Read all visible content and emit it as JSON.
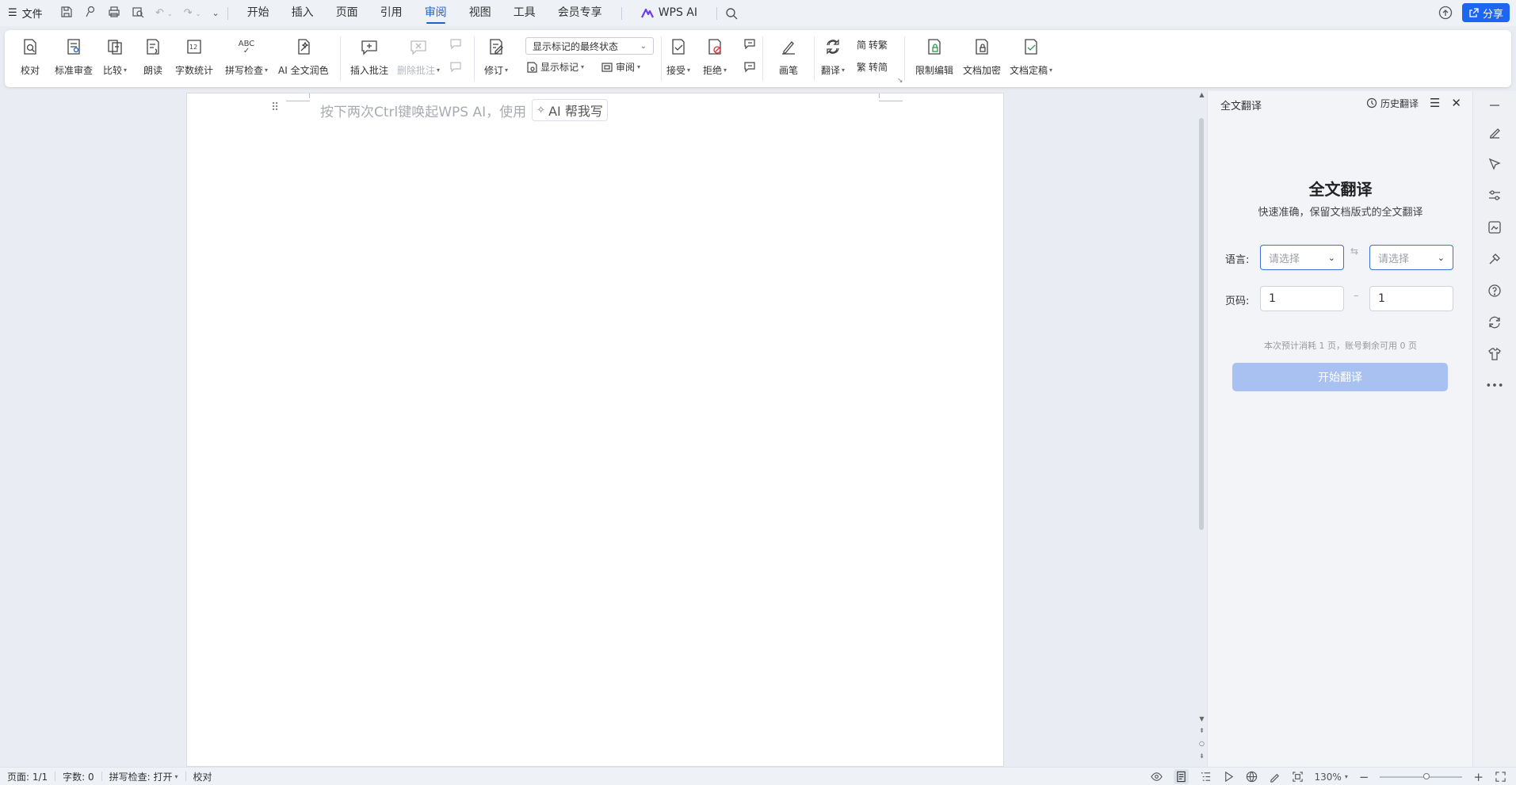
{
  "menubar": {
    "file_label": "文件",
    "tabs": [
      {
        "label": "开始",
        "active": false
      },
      {
        "label": "插入",
        "active": false
      },
      {
        "label": "页面",
        "active": false
      },
      {
        "label": "引用",
        "active": false
      },
      {
        "label": "审阅",
        "active": true
      },
      {
        "label": "视图",
        "active": false
      },
      {
        "label": "工具",
        "active": false
      },
      {
        "label": "会员专享",
        "active": false
      }
    ],
    "wps_ai_label": "WPS AI",
    "share_label": "分享"
  },
  "ribbon": {
    "proofread": "校对",
    "standard_review": "标准审查",
    "compare": "比较",
    "read_aloud": "朗读",
    "word_count": "字数统计",
    "spell_check": "拼写检查",
    "spell_icon_text": "ABC",
    "ai_polish": "AI 全文润色",
    "insert_comment": "插入批注",
    "delete_comment": "删除批注",
    "revise": "修订",
    "markup_state": "显示标记的最终状态",
    "show_markup": "显示标记",
    "review": "审阅",
    "accept": "接受",
    "reject": "拒绝",
    "pen": "画笔",
    "translate": "翻译",
    "to_traditional": "转繁",
    "to_simplified": "转简",
    "restrict_edit": "限制编辑",
    "encrypt": "文档加密",
    "finalize": "文档定稿"
  },
  "document": {
    "hint": "按下两次Ctrl键唤起WPS AI，使用",
    "hint_button": "AI 帮我写"
  },
  "panel": {
    "header": "全文翻译",
    "history": "历史翻译",
    "title": "全文翻译",
    "subtitle": "快速准确，保留文档版式的全文翻译",
    "language_label": "语言:",
    "source_placeholder": "请选择",
    "target_placeholder": "请选择",
    "page_label": "页码:",
    "page_from": "1",
    "page_to": "1",
    "estimate": "本次预计消耗 1 页，账号剩余可用 0 页",
    "start_button": "开始翻译"
  },
  "status": {
    "page": "页面: 1/1",
    "word_count": "字数: 0",
    "spell_check": "拼写检查: 打开",
    "proofread": "校对",
    "zoom": "130%"
  },
  "colors": {
    "accent": "#1d5fd6",
    "share_bg": "#1d66f0",
    "start_btn_bg": "#a9c1f0"
  }
}
